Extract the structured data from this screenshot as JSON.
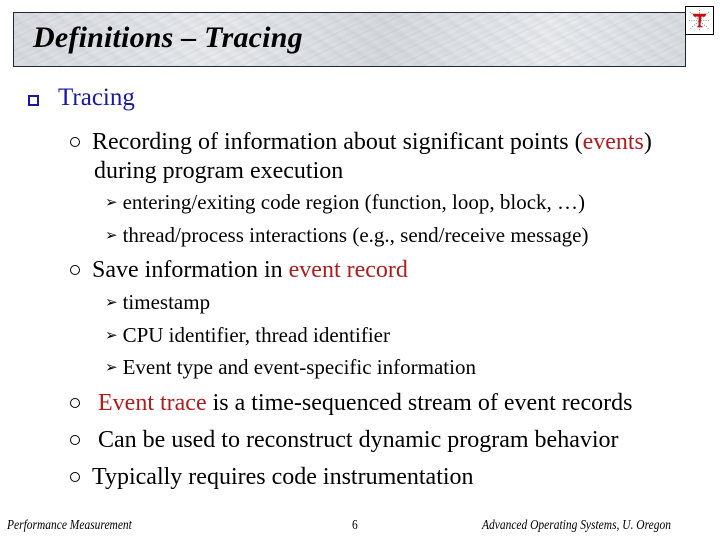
{
  "header": {
    "title": "Definitions – Tracing",
    "logo_icon": "tau-logo-icon"
  },
  "content": {
    "heading": "Tracing",
    "items": [
      {
        "text_parts": [
          "Recording of information about significant points (",
          "events",
          ")"
        ],
        "continuation": "during program execution",
        "subitems": [
          "entering/exiting code region (function, loop, block, …)",
          "thread/process interactions (e.g., send/receive message)"
        ]
      },
      {
        "text_parts": [
          "Save information in ",
          "event record"
        ],
        "subitems": [
          "timestamp",
          "CPU identifier, thread identifier",
          "Event type and event-specific information"
        ]
      },
      {
        "text_parts": [
          "Event trace",
          " is a time-sequenced stream of event records"
        ]
      },
      {
        "text": "Can be used to reconstruct dynamic program behavior"
      },
      {
        "text": "Typically requires code instrumentation"
      }
    ],
    "accent_color": "#b01c1c",
    "heading_color": "#1a1aa0"
  },
  "footer": {
    "left": "Performance Measurement",
    "page_number": "6",
    "right": "Advanced Operating Systems, U. Oregon"
  }
}
